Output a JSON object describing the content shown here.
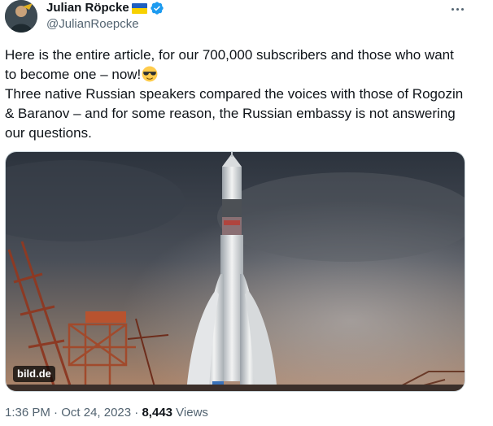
{
  "author": {
    "display_name": "Julian Röpcke",
    "handle": "@JulianRoepcke",
    "flag_icon": "ukraine-flag-icon",
    "verified_icon": "verified-badge-icon",
    "verified_color": "#1d9bf0"
  },
  "more_icon": "more-horizontal-icon",
  "tweet": {
    "line1": "Here is the entire article, for our 700,000 subscribers and those who want to become one – now!",
    "emoji": "smiling-face-with-sunglasses",
    "line2": "Three native Russian speakers compared the voices with those of Rogozin & Baranov – and for some reason, the Russian embassy is not answering our questions."
  },
  "media": {
    "source_label": "bild.de",
    "alt": "Soyuz rocket on launch pad"
  },
  "meta": {
    "time": "1:36 PM",
    "separator1": " · ",
    "date": "Oct 24, 2023",
    "separator2": " · ",
    "views_count": "8,443",
    "views_label": " Views"
  },
  "colors": {
    "text_primary": "#0f1419",
    "text_secondary": "#536471",
    "border": "#cfd9de"
  }
}
